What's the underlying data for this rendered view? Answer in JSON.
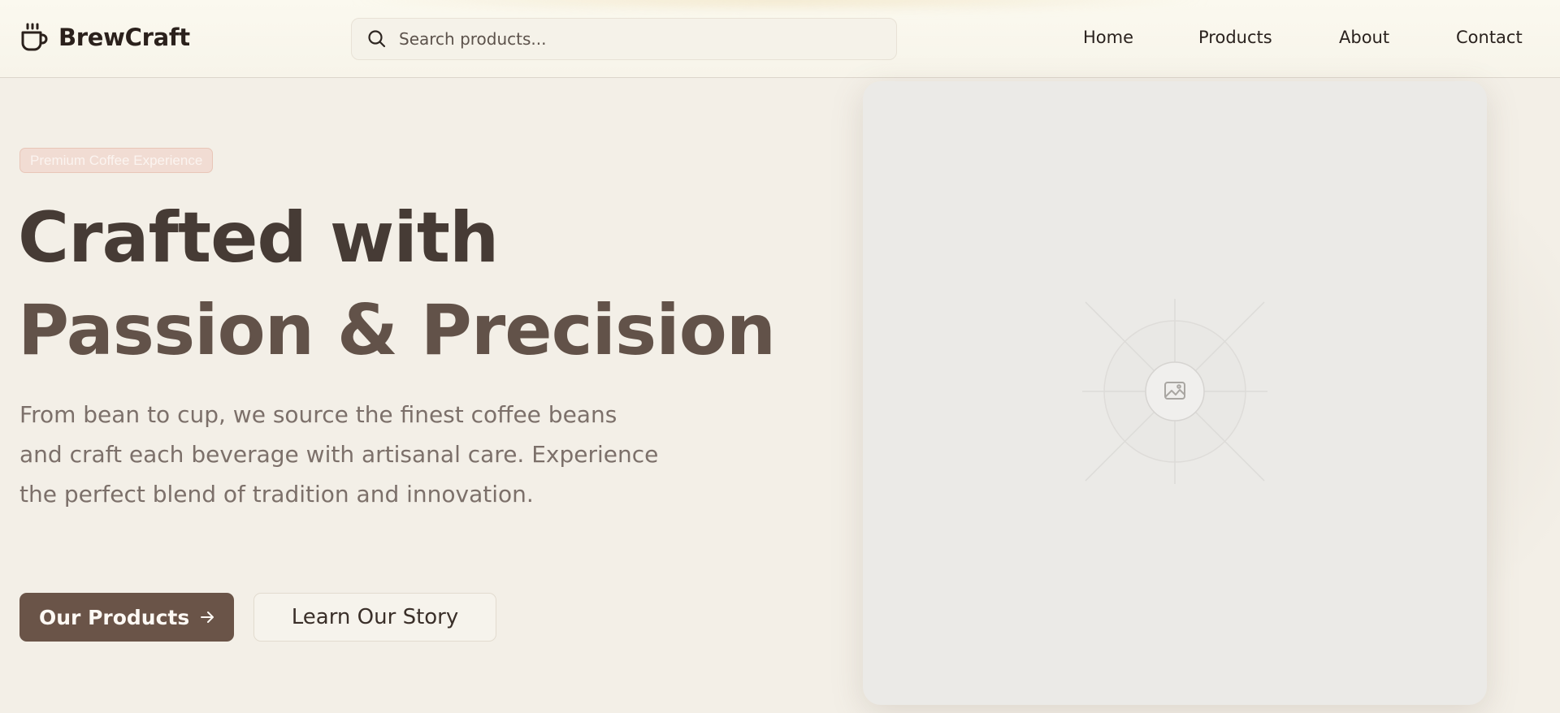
{
  "header": {
    "brand": "BrewCraft",
    "logo_icon": "coffee-cup-icon",
    "search": {
      "placeholder": "Search products...",
      "icon": "search-icon"
    },
    "nav": [
      {
        "label": "Home"
      },
      {
        "label": "Products"
      },
      {
        "label": "About"
      },
      {
        "label": "Contact"
      }
    ]
  },
  "hero": {
    "badge": "Premium Coffee Experience",
    "headline_line1": "Crafted with",
    "headline_line2": "Passion & Precision",
    "description": "From bean to cup, we source the finest coffee beans and craft each beverage with artisanal care. Experience the perfect blend of tradition and innovation.",
    "primary_cta": {
      "label": "Our Products",
      "icon": "arrow-right-icon"
    },
    "secondary_cta": {
      "label": "Learn Our Story"
    },
    "image": {
      "icon": "image-placeholder-icon"
    }
  },
  "colors": {
    "background": "#f3efe7",
    "brand_dark": "#2b211c",
    "primary_button": "#6a5448",
    "headline_line1": "#463b35",
    "headline_line2": "#625249",
    "body_text": "#7c706a",
    "badge_bg": "#f1dcd3"
  }
}
